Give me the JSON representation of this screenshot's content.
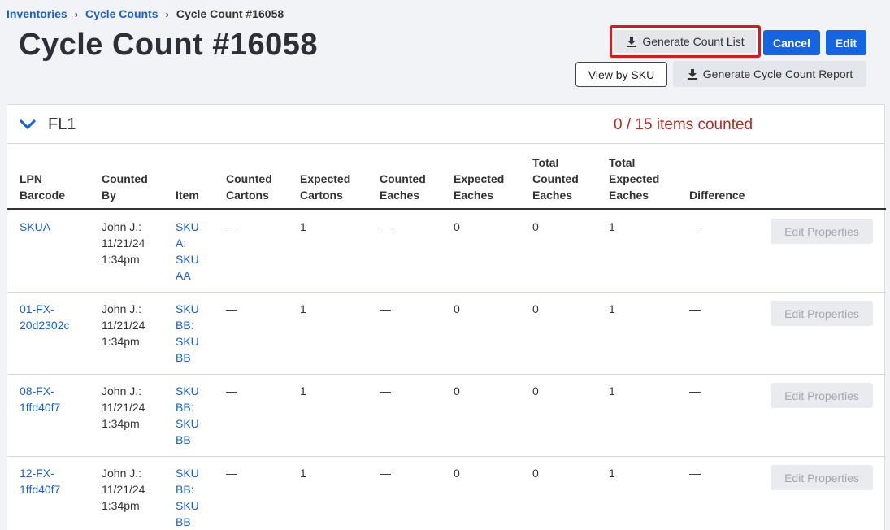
{
  "breadcrumb": {
    "items": [
      "Inventories",
      "Cycle Counts",
      "Cycle Count #16058"
    ]
  },
  "page": {
    "title": "Cycle Count #16058"
  },
  "actions": {
    "generate_count_list": "Generate Count List",
    "cancel": "Cancel",
    "edit": "Edit",
    "view_by_sku": "View by SKU",
    "generate_report": "Generate Cycle Count Report"
  },
  "section": {
    "name": "FL1",
    "status": "0 / 15 items counted"
  },
  "table": {
    "headers": {
      "lpn": [
        "LPN",
        "Barcode"
      ],
      "counted_by": [
        "Counted",
        "By"
      ],
      "item": [
        "Item"
      ],
      "counted_cartons": [
        "Counted",
        "Cartons"
      ],
      "expected_cartons": [
        "Expected",
        "Cartons"
      ],
      "counted_eaches": [
        "Counted",
        "Eaches"
      ],
      "expected_eaches": [
        "Expected",
        "Eaches"
      ],
      "total_counted": [
        "Total",
        "Counted",
        "Eaches"
      ],
      "total_expected": [
        "Total",
        "Expected",
        "Eaches"
      ],
      "difference": [
        "Difference"
      ]
    },
    "row_action": "Edit Properties",
    "rows": [
      {
        "lpn": [
          "SKUA"
        ],
        "counted_by": [
          "John J.:",
          "11/21/24",
          "1:34pm"
        ],
        "item": [
          "SKU",
          "A:",
          "SKU",
          "AA"
        ],
        "counted_cartons": "—",
        "expected_cartons": "1",
        "counted_eaches": "—",
        "expected_eaches": "0",
        "total_counted": "0",
        "total_expected": "1",
        "difference": "—"
      },
      {
        "lpn": [
          "01-FX-",
          "20d2302c"
        ],
        "counted_by": [
          "John J.:",
          "11/21/24",
          "1:34pm"
        ],
        "item": [
          "SKU",
          "BB:",
          "SKU",
          "BB"
        ],
        "counted_cartons": "—",
        "expected_cartons": "1",
        "counted_eaches": "—",
        "expected_eaches": "0",
        "total_counted": "0",
        "total_expected": "1",
        "difference": "—"
      },
      {
        "lpn": [
          "08-FX-",
          "1ffd40f7"
        ],
        "counted_by": [
          "John J.:",
          "11/21/24",
          "1:34pm"
        ],
        "item": [
          "SKU",
          "BB:",
          "SKU",
          "BB"
        ],
        "counted_cartons": "—",
        "expected_cartons": "1",
        "counted_eaches": "—",
        "expected_eaches": "0",
        "total_counted": "0",
        "total_expected": "1",
        "difference": "—"
      },
      {
        "lpn": [
          "12-FX-",
          "1ffd40f7"
        ],
        "counted_by": [
          "John J.:",
          "11/21/24",
          "1:34pm"
        ],
        "item": [
          "SKU",
          "BB:",
          "SKU",
          "BB"
        ],
        "counted_cartons": "—",
        "expected_cartons": "1",
        "counted_eaches": "—",
        "expected_eaches": "0",
        "total_counted": "0",
        "total_expected": "1",
        "difference": "—"
      }
    ]
  }
}
